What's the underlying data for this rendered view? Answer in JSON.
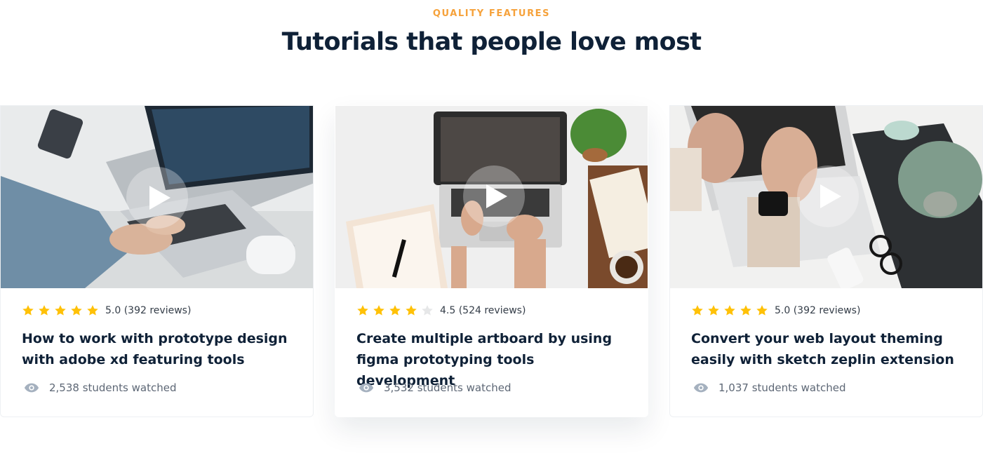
{
  "section": {
    "eyebrow": "QUALITY FEATURES",
    "title": "Tutorials that people love most"
  },
  "colors": {
    "accent": "#f6a23b",
    "heading": "#0f2137",
    "star_filled": "#ffc107",
    "star_empty": "#e6e7e8",
    "muted_icon": "#a5b1bf"
  },
  "cards": [
    {
      "image": "person typing on laptop with website design on screen",
      "rating": 5.0,
      "rating_label": "5.0 (392 reviews)",
      "title": "How to work with prototype design with adobe xd featuring tools",
      "watched_label": "2,538 students watched",
      "icon": "eye-icon"
    },
    {
      "image": "top view of laptop on desk with plant, notebook and coffee",
      "rating": 4.5,
      "rating_label": "4.5 (524 reviews)",
      "title": "Create multiple artboard by using figma prototyping tools development",
      "watched_label": "3,532 students watched",
      "icon": "eye-icon"
    },
    {
      "image": "hands typing on laptop with smartwatch, plant and glasses",
      "rating": 5.0,
      "rating_label": "5.0 (392 reviews)",
      "title": "Convert your web layout theming easily with sketch zeplin extension",
      "watched_label": "1,037 students watched",
      "icon": "eye-icon"
    }
  ]
}
